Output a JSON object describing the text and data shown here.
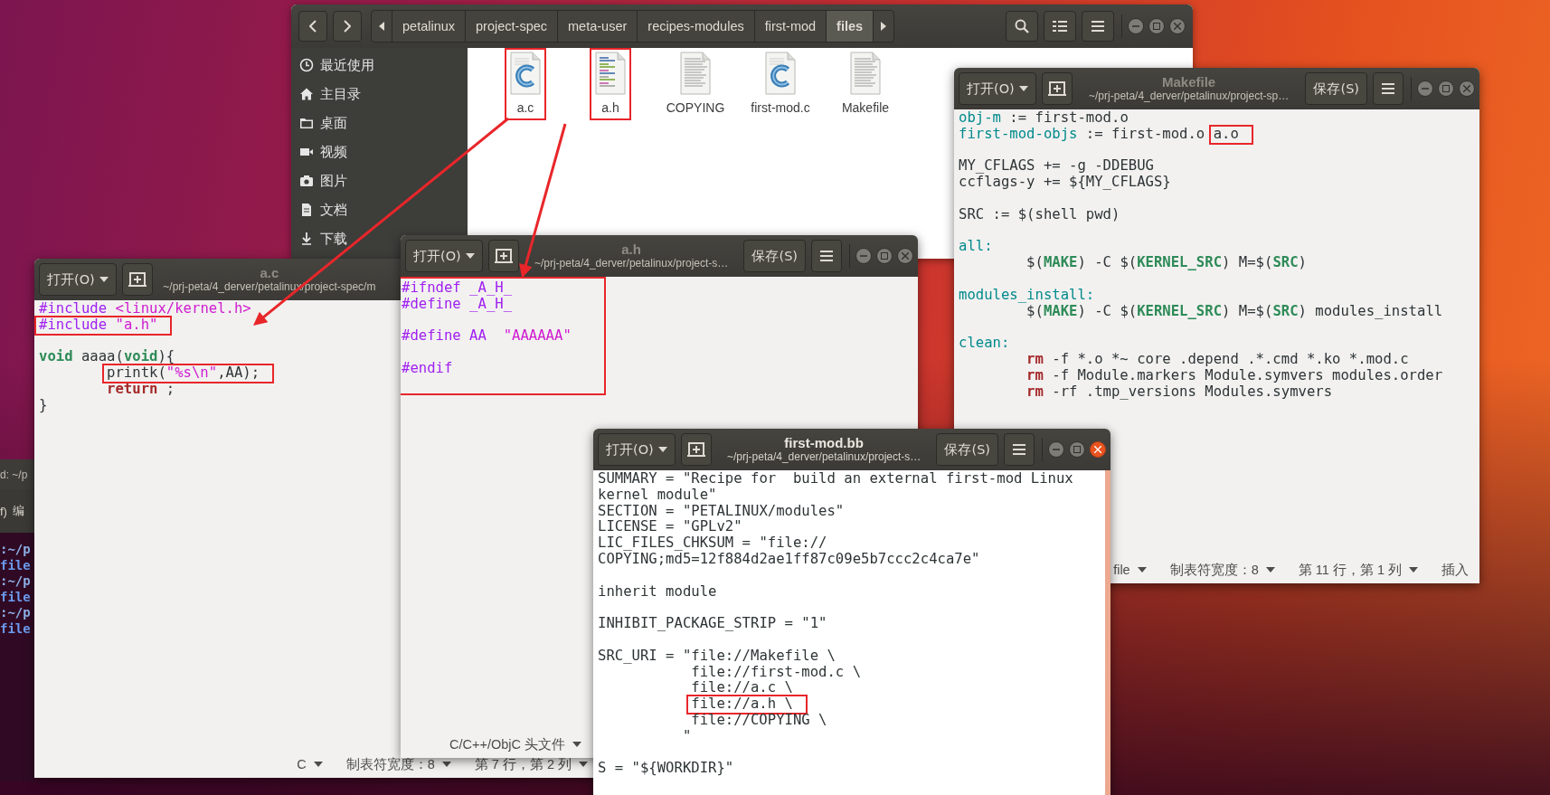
{
  "file_manager": {
    "breadcrumb": [
      {
        "label": "petalinux",
        "selected": false
      },
      {
        "label": "project-spec",
        "selected": false
      },
      {
        "label": "meta-user",
        "selected": false
      },
      {
        "label": "recipes-modules",
        "selected": false
      },
      {
        "label": "first-mod",
        "selected": false
      },
      {
        "label": "files",
        "selected": true
      }
    ],
    "sidebar": [
      {
        "label": "最近使用",
        "kind": "recent"
      },
      {
        "label": "主目录",
        "kind": "home"
      },
      {
        "label": "桌面",
        "kind": "desktop"
      },
      {
        "label": "视频",
        "kind": "videos"
      },
      {
        "label": "图片",
        "kind": "pictures"
      },
      {
        "label": "文档",
        "kind": "documents"
      },
      {
        "label": "下载",
        "kind": "downloads"
      }
    ],
    "files": [
      {
        "name": "a.c",
        "kind": "source",
        "boxed": true
      },
      {
        "name": "a.h",
        "kind": "header",
        "boxed": true
      },
      {
        "name": "COPYING",
        "kind": "text",
        "boxed": false
      },
      {
        "name": "first-mod.c",
        "kind": "source",
        "boxed": false
      },
      {
        "name": "Makefile",
        "kind": "text",
        "boxed": false
      }
    ]
  },
  "terminal": {
    "title": "d: ~/p",
    "menu": [
      "f)",
      "编"
    ],
    "lines": [
      {
        "text": ":~/p",
        "kind": "prompt"
      },
      {
        "text": "file",
        "kind": "output"
      },
      {
        "text": ":~/p",
        "kind": "prompt"
      },
      {
        "text": "file",
        "kind": "output"
      },
      {
        "text": ":~/p",
        "kind": "prompt"
      },
      {
        "text": "file",
        "kind": "output"
      }
    ]
  },
  "editors": [
    {
      "title": "Makefile",
      "path": "~/prj-peta/4_derver/petalinux/project-sp…",
      "open_label": "打开(O)",
      "save_label": "保存(S)",
      "active": false,
      "boxed": false,
      "lines": [
        {
          "kind": "code",
          "segments": [
            {
              "text": "obj-m",
              "kind": "variable"
            },
            {
              "text": " := first-mod.o",
              "kind": "plain"
            }
          ]
        },
        {
          "kind": "code",
          "segments": [
            {
              "text": "first-mod-objs",
              "kind": "variable"
            },
            {
              "text": " := first-mod.o ",
              "kind": "plain"
            },
            {
              "boxed": true,
              "segments": [
                {
                  "text": "a.o",
                  "kind": "plain"
                }
              ]
            }
          ]
        },
        {
          "kind": "blank"
        },
        {
          "kind": "code",
          "segments": [
            {
              "text": "MY_CFLAGS += -g -DDEBUG",
              "kind": "plain"
            }
          ]
        },
        {
          "kind": "code",
          "segments": [
            {
              "text": "ccflags-y += ${MY_CFLAGS}",
              "kind": "plain"
            }
          ]
        },
        {
          "kind": "blank"
        },
        {
          "kind": "code",
          "segments": [
            {
              "text": "SRC := $(shell pwd)",
              "kind": "plain"
            }
          ]
        },
        {
          "kind": "blank"
        },
        {
          "kind": "code",
          "segments": [
            {
              "text": "all:",
              "kind": "variable"
            }
          ]
        },
        {
          "kind": "indented",
          "segments": [
            {
              "text": "$(",
              "kind": "plain"
            },
            {
              "text": "MAKE",
              "kind": "builtin"
            },
            {
              "text": ") -C $(",
              "kind": "plain"
            },
            {
              "text": "KERNEL_SRC",
              "kind": "builtin"
            },
            {
              "text": ") M=$(",
              "kind": "plain"
            },
            {
              "text": "SRC",
              "kind": "builtin"
            },
            {
              "text": ")",
              "kind": "plain"
            }
          ]
        },
        {
          "kind": "blank"
        },
        {
          "kind": "code",
          "segments": [
            {
              "text": "modules_install:",
              "kind": "variable"
            }
          ]
        },
        {
          "kind": "indented",
          "segments": [
            {
              "text": "$(",
              "kind": "plain"
            },
            {
              "text": "MAKE",
              "kind": "builtin"
            },
            {
              "text": ") -C $(",
              "kind": "plain"
            },
            {
              "text": "KERNEL_SRC",
              "kind": "builtin"
            },
            {
              "text": ") M=$(",
              "kind": "plain"
            },
            {
              "text": "SRC",
              "kind": "builtin"
            },
            {
              "text": ") modules_install",
              "kind": "plain"
            }
          ]
        },
        {
          "kind": "blank"
        },
        {
          "kind": "code",
          "segments": [
            {
              "text": "clean:",
              "kind": "variable"
            }
          ]
        },
        {
          "kind": "indented",
          "segments": [
            {
              "text": "rm",
              "kind": "keyword"
            },
            {
              "text": " -f *.o *~ core .depend .*.cmd *.ko *.mod.c",
              "kind": "plain"
            }
          ]
        },
        {
          "kind": "indented",
          "segments": [
            {
              "text": "rm",
              "kind": "keyword"
            },
            {
              "text": " -f Module.markers Module.symvers modules.order",
              "kind": "plain"
            }
          ]
        },
        {
          "kind": "indented",
          "segments": [
            {
              "text": "rm",
              "kind": "keyword"
            },
            {
              "text": " -rf .tmp_versions Modules.symvers",
              "kind": "plain"
            }
          ]
        }
      ],
      "status": [
        {
          "text": "file",
          "dropdown": true
        },
        {
          "text": "制表符宽度：8",
          "dropdown": true
        },
        {
          "text": "第 11 行，第 1 列",
          "dropdown": true
        },
        {
          "text": "插入",
          "dropdown": false
        }
      ]
    },
    {
      "title": "a.c",
      "path": "~/prj-peta/4_derver/petalinux/project-spec/m",
      "open_label": "打开(O)",
      "active": false,
      "boxed": false,
      "lines": [
        {
          "kind": "code",
          "segments": [
            {
              "text": "#include ",
              "kind": "preproc"
            },
            {
              "text": "<linux/kernel.h>",
              "kind": "string"
            }
          ]
        },
        {
          "kind": "code",
          "segments": [
            {
              "boxed": true,
              "segments": [
                {
                  "text": "#include ",
                  "kind": "preproc"
                },
                {
                  "text": "\"a.h\"",
                  "kind": "string"
                }
              ]
            }
          ]
        },
        {
          "kind": "blank"
        },
        {
          "kind": "code",
          "segments": [
            {
              "text": "void",
              "kind": "type"
            },
            {
              "text": " aaaa(",
              "kind": "plain"
            },
            {
              "text": "void",
              "kind": "type"
            },
            {
              "text": "){",
              "kind": "plain"
            }
          ]
        },
        {
          "kind": "indented",
          "segments": [
            {
              "boxed": true,
              "segments": [
                {
                  "text": "printk(",
                  "kind": "plain"
                },
                {
                  "text": "\"%s\\n\"",
                  "kind": "string"
                },
                {
                  "text": ",AA);",
                  "kind": "plain"
                }
              ]
            }
          ]
        },
        {
          "kind": "indented",
          "segments": [
            {
              "text": "return",
              "kind": "keyword"
            },
            {
              "text": " ;",
              "kind": "plain"
            }
          ]
        },
        {
          "kind": "code",
          "segments": [
            {
              "text": "}",
              "kind": "plain"
            }
          ]
        }
      ],
      "status": [
        {
          "text": "C",
          "dropdown": true
        },
        {
          "text": "制表符宽度：8",
          "dropdown": true
        },
        {
          "text": "第 7 行，第 2 列",
          "dropdown": true
        }
      ]
    },
    {
      "title": "a.h",
      "path": "~/prj-peta/4_derver/petalinux/project-s…",
      "open_label": "打开(O)",
      "save_label": "保存(S)",
      "active": false,
      "boxed": true,
      "lines": [
        {
          "kind": "code",
          "segments": [
            {
              "text": "#ifndef _A_H_",
              "kind": "preproc"
            }
          ]
        },
        {
          "kind": "code",
          "segments": [
            {
              "text": "#define _A_H_",
              "kind": "preproc"
            }
          ]
        },
        {
          "kind": "blank"
        },
        {
          "kind": "code",
          "segments": [
            {
              "text": "#define AA  ",
              "kind": "preproc"
            },
            {
              "text": "\"AAAAAA\"",
              "kind": "string"
            }
          ]
        },
        {
          "kind": "blank"
        },
        {
          "kind": "code",
          "segments": [
            {
              "text": "#endif",
              "kind": "preproc"
            }
          ]
        }
      ],
      "status": [
        {
          "text": "C/C++/ObjC 头文件",
          "dropdown": true
        }
      ]
    },
    {
      "title": "first-mod.bb",
      "path": "~/prj-peta/4_derver/petalinux/project-s…",
      "open_label": "打开(O)",
      "save_label": "保存(S)",
      "active": true,
      "boxed": false,
      "lines": [
        {
          "kind": "code",
          "segments": [
            {
              "text": "SUMMARY = \"Recipe for  build an external first-mod Linux",
              "kind": "plain"
            }
          ]
        },
        {
          "kind": "code",
          "segments": [
            {
              "text": "kernel module\"",
              "kind": "plain"
            }
          ]
        },
        {
          "kind": "code",
          "segments": [
            {
              "text": "SECTION = \"PETALINUX/modules\"",
              "kind": "plain"
            }
          ]
        },
        {
          "kind": "code",
          "segments": [
            {
              "text": "LICENSE = \"GPLv2\"",
              "kind": "plain"
            }
          ]
        },
        {
          "kind": "code",
          "segments": [
            {
              "text": "LIC_FILES_CHKSUM = \"file://",
              "kind": "plain"
            }
          ]
        },
        {
          "kind": "code",
          "segments": [
            {
              "text": "COPYING;md5=12f884d2ae1ff87c09e5b7ccc2c4ca7e\"",
              "kind": "plain"
            }
          ]
        },
        {
          "kind": "blank"
        },
        {
          "kind": "code",
          "segments": [
            {
              "text": "inherit module",
              "kind": "plain"
            }
          ]
        },
        {
          "kind": "blank"
        },
        {
          "kind": "code",
          "segments": [
            {
              "text": "INHIBIT_PACKAGE_STRIP = \"1\"",
              "kind": "plain"
            }
          ]
        },
        {
          "kind": "blank"
        },
        {
          "kind": "code",
          "segments": [
            {
              "text": "SRC_URI = \"file://Makefile \\",
              "kind": "plain"
            }
          ]
        },
        {
          "kind": "continued",
          "segments": [
            {
              "text": "file://first-mod.c \\",
              "kind": "plain"
            }
          ]
        },
        {
          "kind": "continued",
          "segments": [
            {
              "text": "file://a.c \\",
              "kind": "plain"
            }
          ]
        },
        {
          "kind": "continued",
          "segments": [
            {
              "boxed": true,
              "segments": [
                {
                  "text": "file://a.h \\",
                  "kind": "plain"
                }
              ]
            }
          ]
        },
        {
          "kind": "continued",
          "segments": [
            {
              "text": "file://COPYING \\",
              "kind": "plain"
            }
          ]
        },
        {
          "kind": "code",
          "segments": [
            {
              "text": "          \"",
              "kind": "plain"
            }
          ]
        },
        {
          "kind": "blank"
        },
        {
          "kind": "code",
          "segments": [
            {
              "text": "S = \"${WORKDIR}\"",
              "kind": "plain"
            }
          ]
        }
      ]
    }
  ]
}
